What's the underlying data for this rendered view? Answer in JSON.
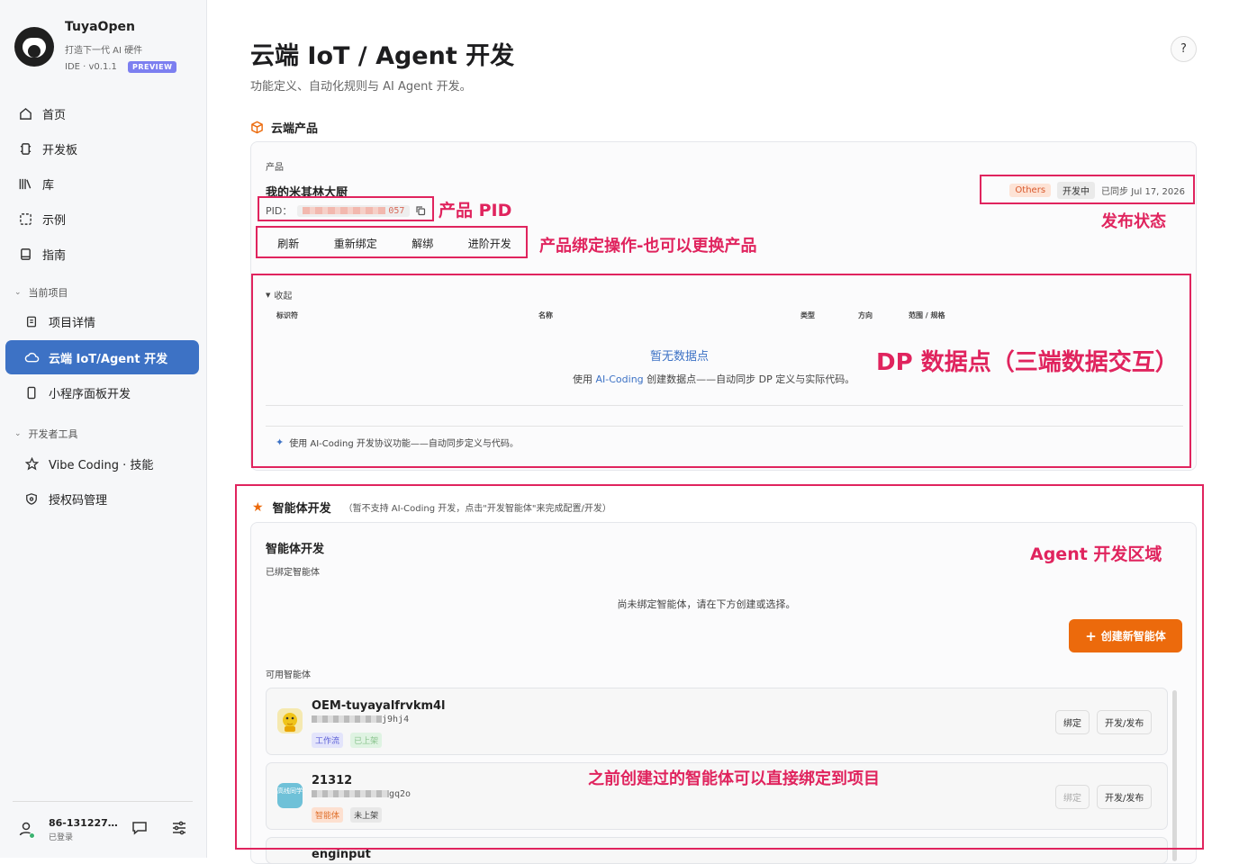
{
  "sidebar": {
    "brand": {
      "name": "TuyaOpen",
      "slogan": "打造下一代 AI 硬件",
      "version": "IDE · v0.1.1",
      "badge": "PREVIEW"
    },
    "items": [
      {
        "label": "首页",
        "icon": "home-icon"
      },
      {
        "label": "开发板",
        "icon": "chip-icon"
      },
      {
        "label": "库",
        "icon": "library-icon"
      },
      {
        "label": "示例",
        "icon": "examples-icon"
      },
      {
        "label": "指南",
        "icon": "book-icon"
      }
    ],
    "section_project": "当前项目",
    "project_items": [
      {
        "label": "项目详情",
        "icon": "document-icon"
      },
      {
        "label": "云端 IoT/Agent 开发",
        "icon": "cloud-icon"
      },
      {
        "label": "小程序面板开发",
        "icon": "phone-icon"
      }
    ],
    "section_tools": "开发者工具",
    "tool_items": [
      {
        "label": "Vibe Coding · 技能",
        "icon": "star-icon"
      },
      {
        "label": "授权码管理",
        "icon": "shield-icon"
      }
    ],
    "user": {
      "name": "86-131227…",
      "status": "已登录"
    }
  },
  "header": {
    "title": "云端 IoT / Agent 开发",
    "subtitle": "功能定义、自动化规则与 AI Agent 开发。",
    "help": "?"
  },
  "cloud": {
    "section_title": "云端产品",
    "product_label": "产品",
    "product_name": "我的米其林大厨",
    "pid_label": "PID：",
    "pid_suffix": "057",
    "tags": {
      "others": "Others",
      "developing": "开发中",
      "sync": "已同步 Jul 17, 2026"
    },
    "actions": [
      "刷新",
      "重新绑定",
      "解绑",
      "进阶开发"
    ],
    "collapse": "收起",
    "columns": [
      "标识符",
      "名称",
      "类型",
      "方向",
      "范围 / 规格"
    ],
    "empty_title": "暂无数据点",
    "empty_desc_pre": "使用 ",
    "empty_desc_link": "AI-Coding",
    "empty_desc_post": " 创建数据点——自动同步 DP 定义与实际代码。",
    "tip": "使用 AI-Coding 开发协议功能——自动同步定义与代码。"
  },
  "agent": {
    "section_title": "智能体开发",
    "section_note": "（暂不支持 AI-Coding 开发，点击\"开发智能体\"来完成配置/开发）",
    "card_title": "智能体开发",
    "bound_label": "已绑定智能体",
    "unbound_text": "尚未绑定智能体，请在下方创建或选择。",
    "create_button": "创建新智能体",
    "available_label": "可用智能体",
    "agents": [
      {
        "name": "OEM-tuyayalfrvkm4l",
        "id_suffix": "j9hj4",
        "tags": [
          "工作流",
          "已上架"
        ],
        "bind": "绑定",
        "publish": "开发/发布",
        "avatar_text": ""
      },
      {
        "name": "21312",
        "id_suffix": "gq2o",
        "tags": [
          "智能体",
          "未上架"
        ],
        "bind": "绑定",
        "publish": "开发/发布",
        "avatar_text": "高线同学"
      },
      {
        "name": "enginput"
      }
    ]
  },
  "annotations": {
    "pid": "产品 PID",
    "status": "发布状态",
    "binding": "产品绑定操作-也可以更换产品",
    "dp": "DP 数据点（三端数据交互）",
    "agent_area": "Agent 开发区域",
    "agent_bind": "之前创建过的智能体可以直接绑定到项目"
  },
  "colors": {
    "accent": "#3d72c5",
    "annotation": "#e0245e",
    "create_button": "#ec6a0c",
    "link": "#3d72c5"
  }
}
